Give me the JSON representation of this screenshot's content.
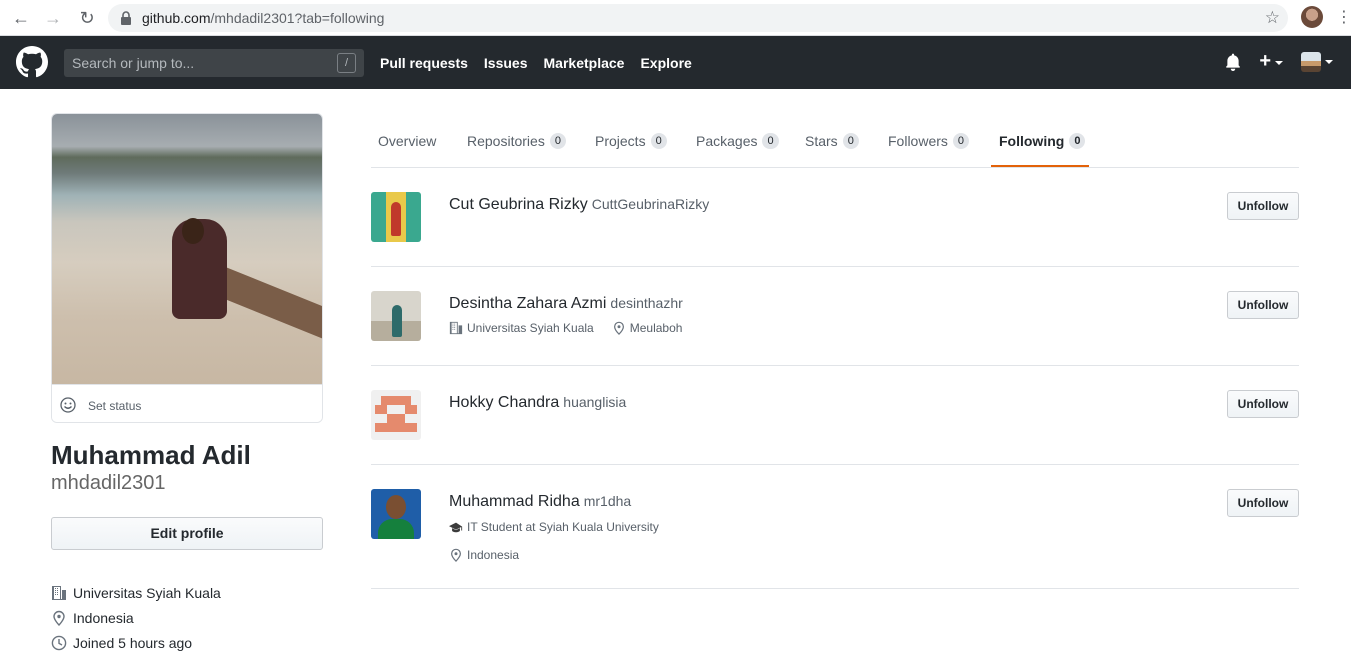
{
  "browser": {
    "url_host": "github.com",
    "url_path": "/mhdadil2301?tab=following"
  },
  "header": {
    "search_placeholder": "Search or jump to...",
    "search_key": "/",
    "nav": [
      "Pull requests",
      "Issues",
      "Marketplace",
      "Explore"
    ],
    "plus": "+"
  },
  "profile": {
    "set_status": "Set status",
    "full_name": "Muhammad Adil",
    "username": "mhdadil2301",
    "edit_profile": "Edit profile",
    "company": "Universitas Syiah Kuala",
    "location": "Indonesia",
    "joined": "Joined 5 hours ago"
  },
  "tabs": [
    {
      "label": "Overview",
      "count": ""
    },
    {
      "label": "Repositories",
      "count": "0"
    },
    {
      "label": "Projects",
      "count": "0"
    },
    {
      "label": "Packages",
      "count": "0"
    },
    {
      "label": "Stars",
      "count": "0"
    },
    {
      "label": "Followers",
      "count": "0"
    },
    {
      "label": "Following",
      "count": "0"
    }
  ],
  "following": [
    {
      "name": "Cut Geubrina Rizky",
      "login": "CuttGeubrinaRizky",
      "button": "Unfollow"
    },
    {
      "name": "Desintha Zahara Azmi",
      "login": "desinthazhr",
      "company": "Universitas Syiah Kuala",
      "location": "Meulaboh",
      "button": "Unfollow"
    },
    {
      "name": "Hokky Chandra",
      "login": "huanglisia",
      "button": "Unfollow"
    },
    {
      "name": "Muhammad Ridha",
      "login": "mr1dha",
      "bio": "IT Student at Syiah Kuala University",
      "location": "Indonesia",
      "button": "Unfollow"
    }
  ],
  "colors": {
    "header_bg": "#24292e",
    "tab_underline": "#e36209"
  }
}
